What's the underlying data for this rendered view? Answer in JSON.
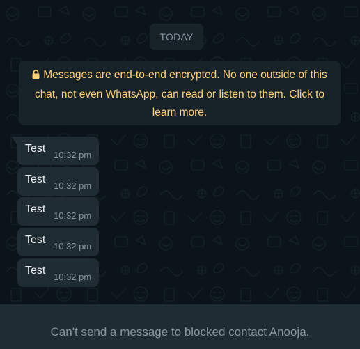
{
  "chat": {
    "date_separator": "TODAY",
    "encryption_notice": "Messages are end-to-end encrypted. No one outside of this chat, not even WhatsApp, can read or listen to them. Click to learn more.",
    "messages": [
      {
        "text": "Test",
        "time": "10:32 pm"
      },
      {
        "text": "Test",
        "time": "10:32 pm"
      },
      {
        "text": "Test",
        "time": "10:32 pm"
      },
      {
        "text": "Test",
        "time": "10:32 pm"
      },
      {
        "text": "Test",
        "time": "10:32 pm"
      }
    ]
  },
  "footer": {
    "blocked_message": "Can't send a message to blocked contact Anooja."
  },
  "colors": {
    "background": "#0b141a",
    "bubble": "#202c33",
    "notice_bg": "#182229",
    "notice_text": "#ffd279",
    "meta_text": "#8696a0",
    "primary_text": "#e9edef"
  },
  "icons": {
    "encryption": "lock-icon",
    "bubble_tail": "bubble-tail"
  }
}
